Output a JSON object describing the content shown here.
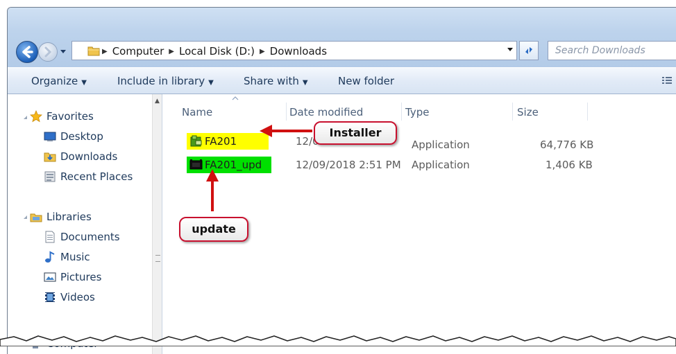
{
  "window": {
    "address": {
      "crumbs": [
        "Computer",
        "Local Disk (D:)",
        "Downloads"
      ]
    },
    "search_placeholder": "Search Downloads"
  },
  "toolbar": {
    "organize": "Organize",
    "include_in_library": "Include in library",
    "share_with": "Share with",
    "new_folder": "New folder"
  },
  "sidebar": {
    "favorites": {
      "label": "Favorites",
      "items": [
        "Desktop",
        "Downloads",
        "Recent Places"
      ]
    },
    "libraries": {
      "label": "Libraries",
      "items": [
        "Documents",
        "Music",
        "Pictures",
        "Videos"
      ]
    },
    "computer_label": "Computer"
  },
  "columns": {
    "name": "Name",
    "date_modified": "Date modified",
    "type": "Type",
    "size": "Size"
  },
  "files": [
    {
      "name": "FA201",
      "date_modified": "12/09",
      "type": "Application",
      "size": "64,776 KB",
      "highlight": "#ffff00",
      "icon": "installer-icon"
    },
    {
      "name": "FA201_upd",
      "date_modified": "12/09/2018 2:51 PM",
      "type": "Application",
      "size": "1,406 KB",
      "highlight": "#00e000",
      "icon": "application-icon"
    }
  ],
  "annotations": {
    "installer": "Installer",
    "update": "update"
  },
  "colors": {
    "callout_border": "#c8102e",
    "arrow": "#d01010"
  }
}
